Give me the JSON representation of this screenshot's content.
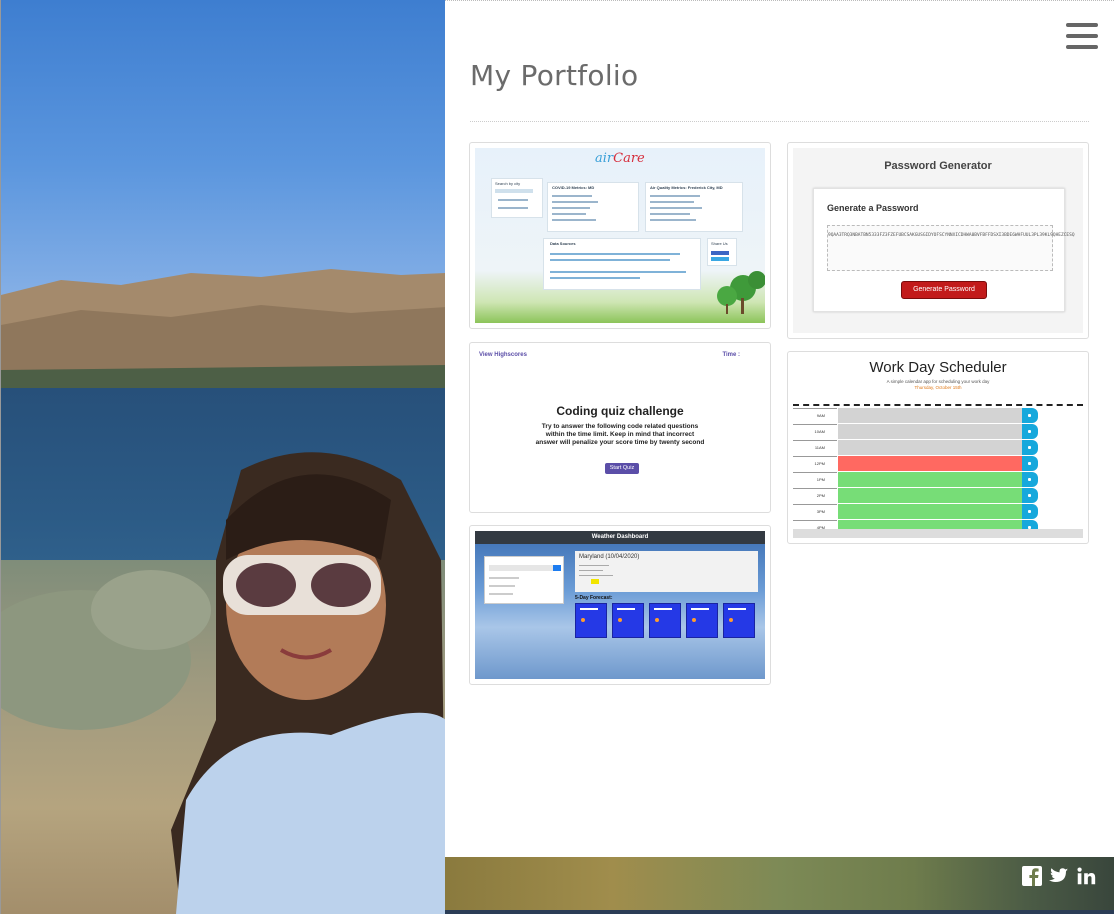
{
  "header": {
    "title": "My Portfolio",
    "menu_icon": "hamburger-menu-icon"
  },
  "projects": {
    "aircare": {
      "logo_a": "air",
      "logo_b": "Care",
      "lines": [
        "Search by city",
        "COVID-19 Metrics: MD",
        "Air Quality Metrics: Frederick City, MD",
        "Data Sources",
        "Share Us"
      ]
    },
    "password_generator": {
      "title": "Password Generator",
      "subtitle": "Generate a Password",
      "password": "9QAA3TRQ3NBATBN5333FZ3FZEFUBCSAKGUSGIDYOFSCYNNXICDHWA0BVFBFFDSXI3BDE6WHFUUL3PL39KL9QHEZCESQ",
      "button": "Generate Password"
    },
    "quiz": {
      "highscores": "View Highscores",
      "time": "Time :",
      "title": "Coding quiz challenge",
      "body": "Try to answer the following code related questions within the time limit. Keep in mind that incorrect answer will penalize your score time by twenty second",
      "button": "Start Quiz"
    },
    "scheduler": {
      "title": "Work Day Scheduler",
      "subtitle": "A simple calendar app for scheduling your work day",
      "date": "Thursday, October 15th",
      "hours": [
        "9AM",
        "10AM",
        "11AM",
        "12PM",
        "1PM",
        "2PM",
        "3PM",
        "4PM",
        "5PM"
      ],
      "states": [
        "past",
        "past",
        "past",
        "present",
        "future",
        "future",
        "future",
        "future",
        "future"
      ],
      "colors": {
        "past": "#d3d3d3",
        "present": "#ff6961",
        "future": "#77dd77",
        "save": "#16a8dc"
      }
    },
    "weather": {
      "title": "Weather Dashboard",
      "city": "Maryland (10/04/2020)",
      "forecast_label": "5-Day Forecast:",
      "days": [
        "10/05/2020",
        "10/06/2020",
        "10/07/2020",
        "10/08/2020",
        "10/09/2020"
      ]
    }
  },
  "footer": {
    "social": [
      "facebook-icon",
      "twitter-icon",
      "linkedin-icon"
    ]
  }
}
